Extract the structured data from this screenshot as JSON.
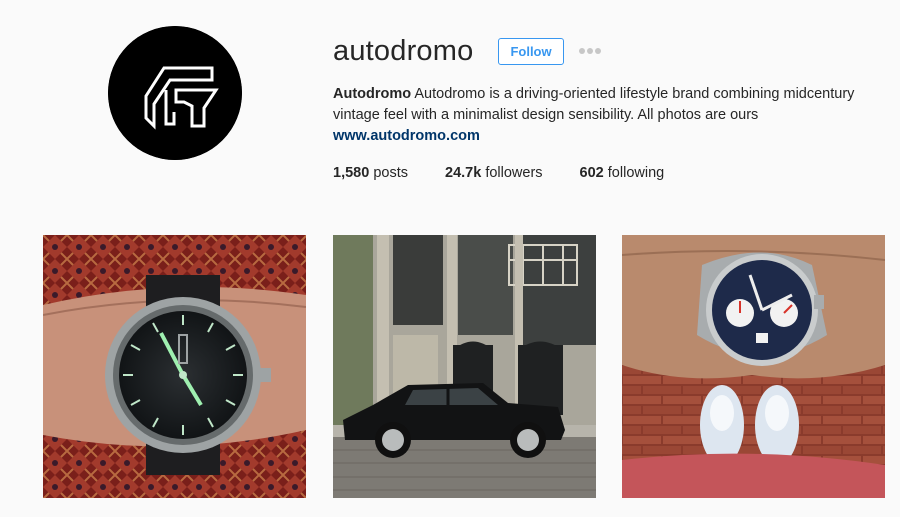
{
  "profile": {
    "username": "autodromo",
    "follow_label": "Follow",
    "more_icon": "ellipsis-icon",
    "bio_name": "Autodromo",
    "bio_text": "Autodromo is a driving-oriented lifestyle brand combining midcentury vintage feel with a minimalist design sensibility. All photos are ours",
    "website": "www.autodromo.com"
  },
  "stats": {
    "posts_count": "1,580",
    "posts_label": "posts",
    "followers_count": "24.7k",
    "followers_label": "followers",
    "following_count": "602",
    "following_label": "following"
  },
  "colors": {
    "accent": "#3897f0",
    "link": "#003569",
    "text": "#262626",
    "background": "#fafafa"
  },
  "posts": [
    {
      "subject": "watch-on-wrist-green-dial"
    },
    {
      "subject": "black-sedan-on-cobblestone-street"
    },
    {
      "subject": "chronograph-watch-over-shoes"
    }
  ]
}
